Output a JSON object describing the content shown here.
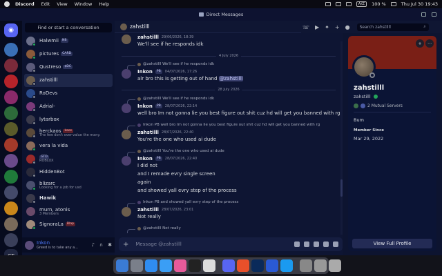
{
  "menubar": {
    "app": "Discord",
    "items": [
      "Edit",
      "View",
      "Window",
      "Help"
    ],
    "kbd": "A/Z",
    "battery": "100 %",
    "datetime": "Thu Jul 30  19:43"
  },
  "titlebar": {
    "title": "Direct Messages"
  },
  "dm_list": {
    "search_label": "Find or start a conversation",
    "items": [
      {
        "name": "Halwmii",
        "tag": "NB",
        "sub": "",
        "status": "online"
      },
      {
        "name": "pictures",
        "tag": "CARD",
        "sub": "",
        "status": "online"
      },
      {
        "name": "Qustreso",
        "tag": "$DC",
        "sub": "",
        "status": "offline"
      },
      {
        "name": "zahstilll",
        "tag": "",
        "sub": "",
        "status": "offline"
      },
      {
        "name": "RoDevs",
        "tag": "",
        "sub": "",
        "status": "offline"
      },
      {
        "name": "Adrial-",
        "tag": "",
        "sub": "",
        "status": "offline"
      },
      {
        "name": "lytarbox",
        "tag": "",
        "sub": "",
        "status": "offline"
      },
      {
        "name": "herckaos",
        "tag": "kaos",
        "sub": "The few don't over-value the many.",
        "status": "offline"
      },
      {
        "name": "vera la vida",
        "tag": "",
        "sub": "",
        "status": "online"
      },
      {
        "name": "ROBLOX",
        "tag": "GTD",
        "sub": "",
        "status": "offline"
      },
      {
        "name": "HiddenBot",
        "tag": "",
        "sub": "",
        "status": "offline"
      },
      {
        "name": "blizarc",
        "tag": "",
        "sub": "Looking for a job for usd",
        "status": "online"
      },
      {
        "name": "Hawik",
        "tag": "",
        "sub": "",
        "status": "offline"
      },
      {
        "name": "murn, atonis",
        "tag": "",
        "sub": "3 Members",
        "status": "offline"
      },
      {
        "name": "SignoraLa",
        "tag": "Blap",
        "sub": "",
        "status": "online"
      }
    ]
  },
  "user_panel": {
    "name": "Inkon",
    "status": "Greed is to take any a..."
  },
  "chat_header": {
    "name": "zahstilll"
  },
  "header_search": {
    "placeholder": "Search zahstilll"
  },
  "messages": {
    "m1": {
      "user": "zahstilll",
      "ts": "29/06/2026, 18:39",
      "lines": [
        "We'll see if he responds idk"
      ]
    },
    "d1": "4 July 2026",
    "m2": {
      "reply": "@zahstilll We'll see if he responds idk",
      "user": "Inkon",
      "tag": "PB",
      "ts": "04/07/2026, 17:26",
      "text": "alr bro this is getting out of hand",
      "mention": "@zahstilll"
    },
    "d2": "28 July 2026",
    "m3": {
      "reply": "@zahstilll We'll see if he responds idk",
      "user": "Inkon",
      "tag": "PB",
      "ts": "28/07/2026, 22:14",
      "text": "well bro Im not gonna lie you best figure out shit cuz hd will get you banned with rg"
    },
    "m4": {
      "reply": "Inkon  PB  well bro Im not gonna lie you best figure out shit cuz hd will get you banned with rg",
      "user": "zahstilll",
      "ts": "28/07/2026, 22:40",
      "text": "You're the one who used ai dude"
    },
    "m5": {
      "reply": "@zahstilll You're the one who used ai dude",
      "user": "Inkon",
      "tag": "PB",
      "ts": "28/07/2026, 22:40",
      "lines": [
        "I did not",
        "and I remade evry single screen",
        "again",
        "and showed yall evry step of the process"
      ]
    },
    "m6": {
      "reply": "Inkon  PB  and showed yall evry step of the process",
      "user": "zahstilll",
      "ts": "28/07/2026, 23:01",
      "text": "Not really"
    },
    "m7": {
      "reply": "@zahstilll Not really"
    }
  },
  "composer": {
    "placeholder": "Message @zahstilll"
  },
  "profile": {
    "display_name": "zahstilll",
    "username": "zahstilll",
    "mutual": "2 Mutual Servers",
    "bio": "Bum",
    "member_since_label": "Member Since",
    "member_since": "Mar 29, 2022",
    "view_full": "View Full Profile"
  },
  "colors": {
    "accent": "#5865f2",
    "online": "#23a55a",
    "banner": "#7a1f16"
  }
}
